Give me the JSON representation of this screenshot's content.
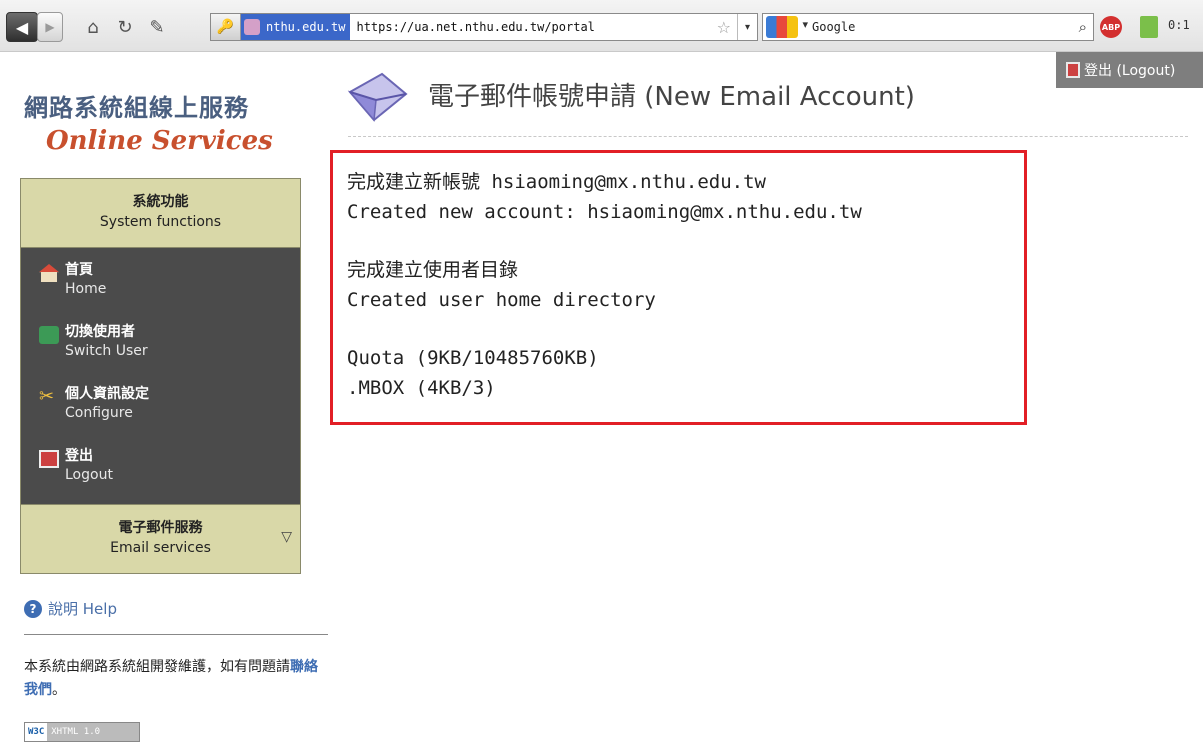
{
  "browser": {
    "site_identity": "nthu.edu.tw",
    "url": "https://ua.net.nthu.edu.tw/portal",
    "search_placeholder": "Google",
    "clock": "0:1"
  },
  "header": {
    "logout_label": "登出 (Logout)"
  },
  "sidebar": {
    "title_cn": "網路系統組線上服務",
    "title_en": "Online Services",
    "menu_header": {
      "cn": "系統功能",
      "en": "System functions"
    },
    "items": [
      {
        "cn": "首頁",
        "en": "Home",
        "icon": "home-icon"
      },
      {
        "cn": "切換使用者",
        "en": "Switch User",
        "icon": "switch-user-icon"
      },
      {
        "cn": "個人資訊設定",
        "en": "Configure",
        "icon": "tools-icon"
      },
      {
        "cn": "登出",
        "en": "Logout",
        "icon": "logout-door-icon"
      }
    ],
    "email_section": {
      "cn": "電子郵件服務",
      "en": "Email services"
    },
    "help_label": "說明 Help",
    "footer_note_before": "本系統由網路系統組開發維護，如有問題請",
    "footer_link": "聯絡我們",
    "footer_note_after": "。",
    "badge_w3c": "W3C",
    "badge_xhtml": "XHTML 1.0"
  },
  "main": {
    "page_title": "電子郵件帳號申請 (New Email Account)",
    "result_lines": {
      "created_cn": "完成建立新帳號 hsiaoming@mx.nthu.edu.tw",
      "created_en": "Created new account: hsiaoming@mx.nthu.edu.tw",
      "homedir_cn": "完成建立使用者目錄",
      "homedir_en": "Created user home directory",
      "quota": "Quota (9KB/10485760KB)",
      "mbox": ".MBOX (4KB/3)"
    }
  }
}
